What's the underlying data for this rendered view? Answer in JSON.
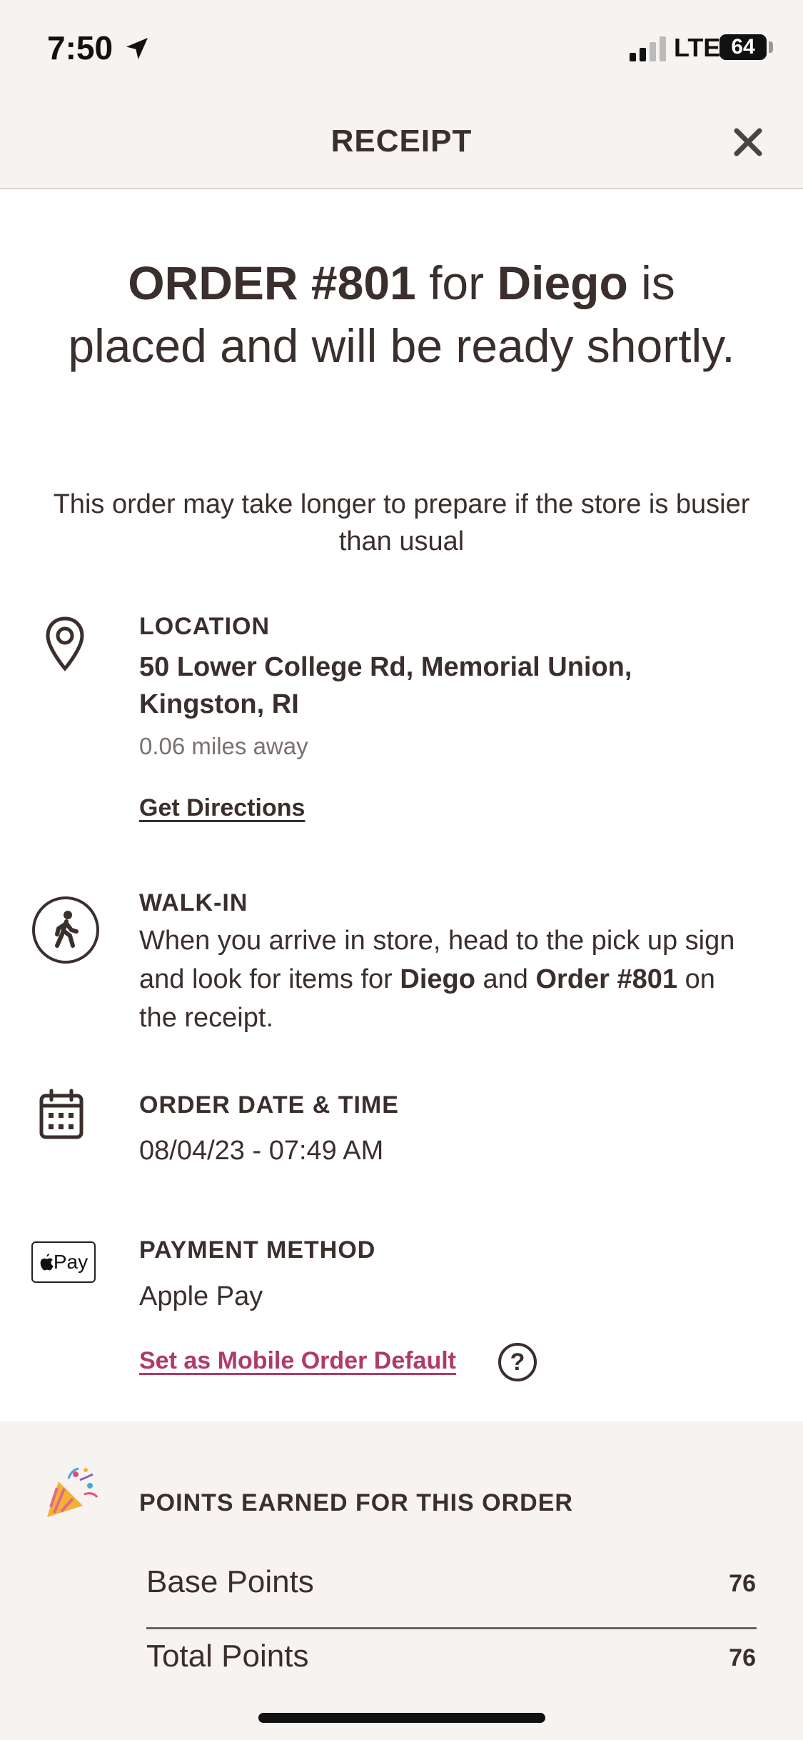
{
  "status_bar": {
    "time": "7:50",
    "network": "LTE",
    "battery": "64"
  },
  "header": {
    "title": "RECEIPT"
  },
  "headline": {
    "order_label": "ORDER #801",
    "for_text": " for ",
    "customer": "Diego",
    "rest": " is placed and will be ready shortly."
  },
  "note": "This order may take longer to prepare if the store is busier than usual",
  "location": {
    "label": "LOCATION",
    "address_line1": "50 Lower College Rd, Memorial Union,",
    "address_line2": "Kingston,  RI",
    "distance": "0.06 miles away",
    "directions_link": "Get Directions"
  },
  "walk_in": {
    "label": "WALK-IN",
    "text_1": "When you arrive in store, head to the pick up sign and look for items for ",
    "name": "Diego",
    "text_2": " and ",
    "order": "Order #801",
    "text_3": " on the receipt."
  },
  "order_time": {
    "label": "ORDER DATE & TIME",
    "value": "08/04/23 - 07:49 AM"
  },
  "payment": {
    "label": "PAYMENT METHOD",
    "logo_text": "Pay",
    "method": "Apple Pay",
    "default_link": "Set as Mobile Order Default",
    "help": "?"
  },
  "points": {
    "title": "POINTS EARNED FOR THIS ORDER",
    "rows": [
      {
        "label": "Base Points",
        "value": "76"
      },
      {
        "label": "Total Points",
        "value": "76"
      }
    ]
  },
  "colors": {
    "text": "#3a2f2c",
    "link_pink": "#b03a68",
    "panel_bg": "#f6f3f1"
  }
}
